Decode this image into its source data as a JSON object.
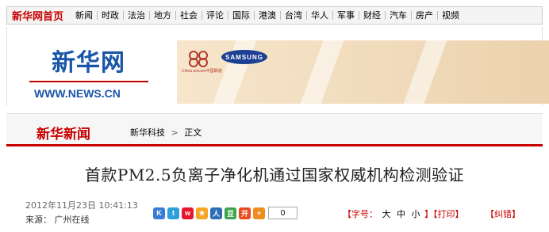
{
  "topnav": {
    "home": "新华网首页",
    "items": [
      "新闻",
      "时政",
      "法治",
      "地方",
      "社会",
      "评论",
      "国际",
      "港澳",
      "台湾",
      "华人",
      "军事",
      "财经",
      "汽车",
      "房产",
      "视频"
    ]
  },
  "logo": {
    "cn": "新华网",
    "en": "WWW.NEWS.CN"
  },
  "banner": {
    "brand": "SAMSUNG",
    "unicom_caption": "China unicom中国联通",
    "colors": {
      "sponsor_blue": "#1c3f94",
      "unicom_red": "#b23a2a"
    }
  },
  "section": {
    "title": "新华新闻",
    "breadcrumb": [
      "新华科技",
      "正文"
    ],
    "separator": ">"
  },
  "article": {
    "headline": "首款PM2.5负离子净化机通过国家权威机构检测验证",
    "datetime": "2012年11月23日  10:41:13",
    "source_label": "来源：",
    "source": "广州在线",
    "share_count": "0",
    "font_size_label": "【字号：",
    "font_sizes": [
      "大",
      "中",
      "小"
    ],
    "print_label": "】【打印】",
    "errata_label": "【纠错】"
  },
  "share_icons": [
    {
      "name": "qq-zone-icon",
      "color": "#3a7bd5",
      "glyph": "K"
    },
    {
      "name": "tencent-weibo-icon",
      "color": "#2e9fd8",
      "glyph": "t"
    },
    {
      "name": "sina-weibo-icon",
      "color": "#e6162d",
      "glyph": "w"
    },
    {
      "name": "qzone-star-icon",
      "color": "#f5a623",
      "glyph": "★"
    },
    {
      "name": "renren-icon",
      "color": "#2d6db5",
      "glyph": "人"
    },
    {
      "name": "douban-icon",
      "color": "#3aa54a",
      "glyph": "豆"
    },
    {
      "name": "kaixin-icon",
      "color": "#e8491d",
      "glyph": "开"
    },
    {
      "name": "more-share-icon",
      "color": "#f08c1e",
      "glyph": "+"
    }
  ],
  "colors": {
    "brand_red": "#c60000",
    "brand_blue": "#1a56a8"
  }
}
